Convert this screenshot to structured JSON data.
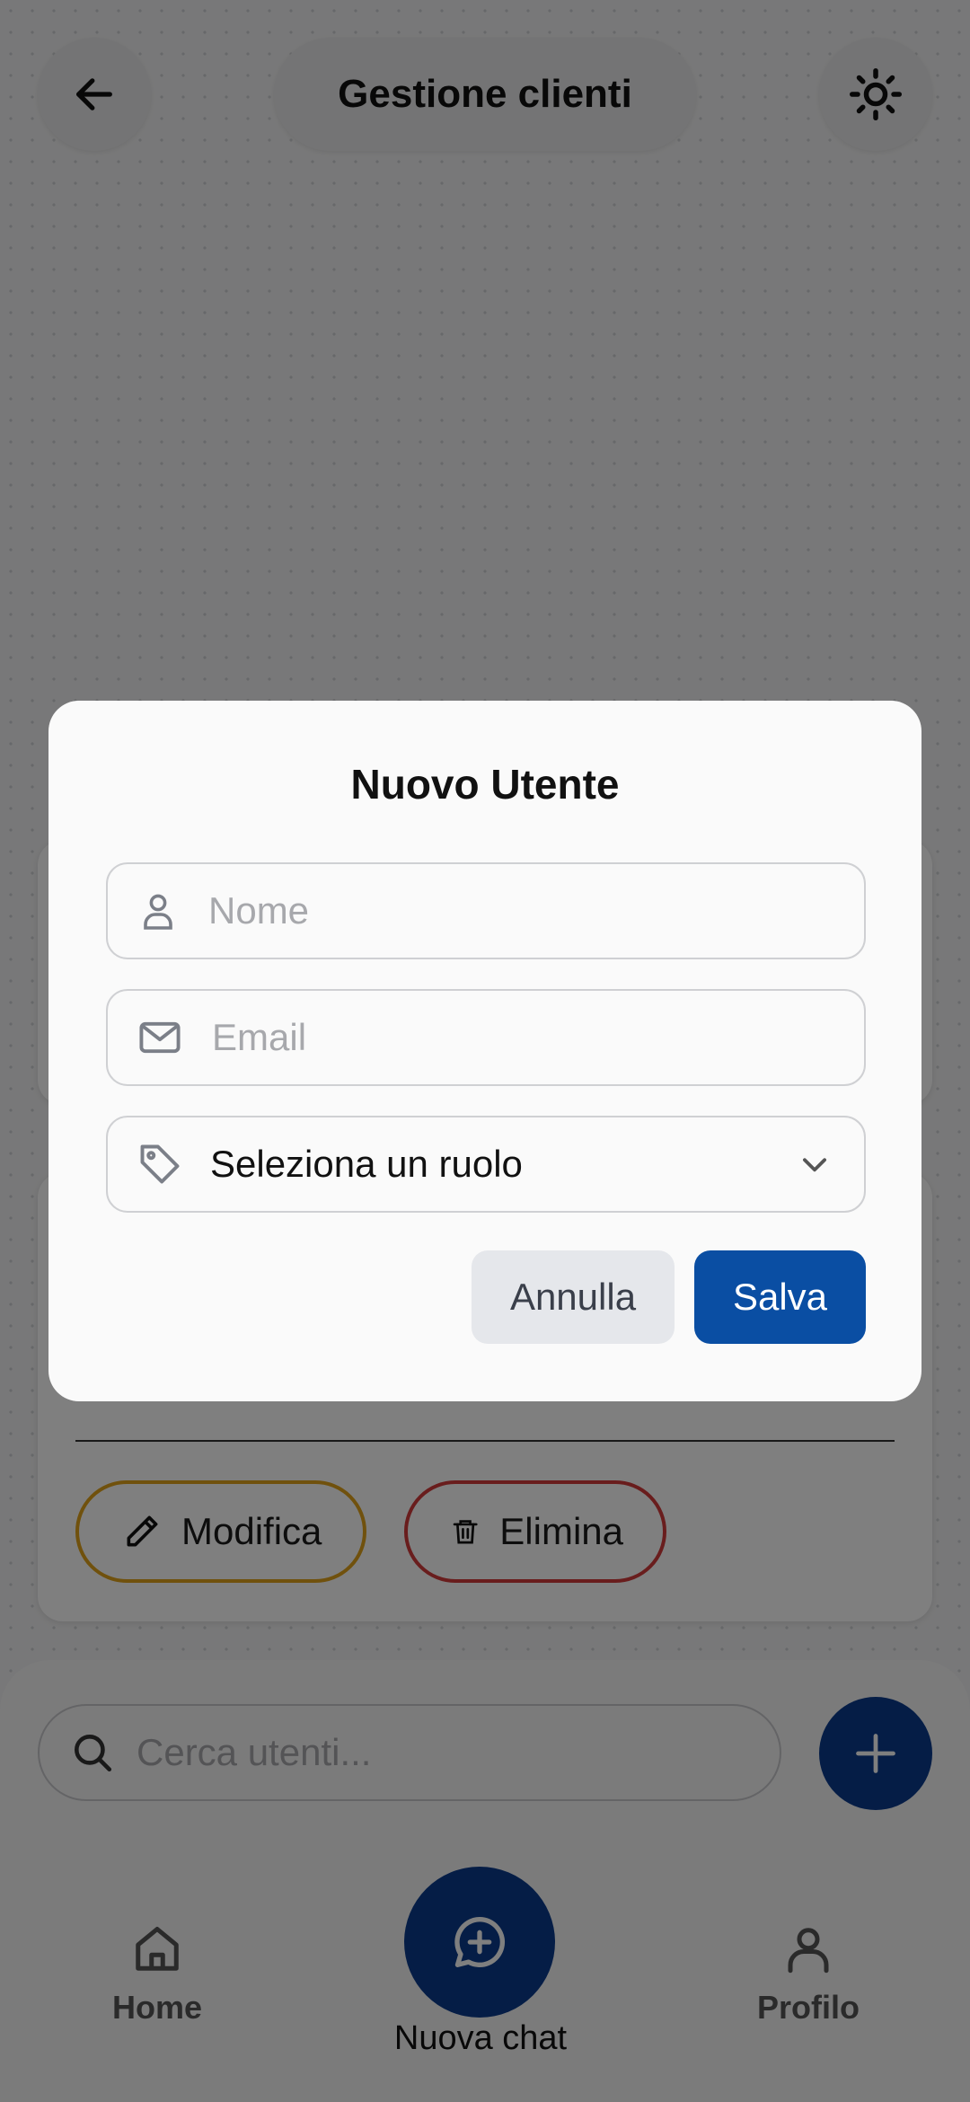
{
  "header": {
    "title": "Gestione clienti",
    "back_icon": "arrow-left-icon",
    "theme_icon": "sun-icon"
  },
  "card": {
    "edit_label": "Modifica",
    "delete_label": "Elimina"
  },
  "search": {
    "placeholder": "Cerca utenti..."
  },
  "bottom_nav": {
    "home_label": "Home",
    "new_chat_label": "Nuova chat",
    "profile_label": "Profilo"
  },
  "modal": {
    "title": "Nuovo Utente",
    "name_placeholder": "Nome",
    "email_placeholder": "Email",
    "role_select": "Seleziona un ruolo",
    "cancel_label": "Annulla",
    "save_label": "Salva"
  },
  "colors": {
    "primary": "#0a3a8c",
    "save_button": "#0a4ea3",
    "edit_border": "#e0a21a",
    "delete_border": "#d23a3a",
    "cancel_bg": "#e5e7eb"
  }
}
